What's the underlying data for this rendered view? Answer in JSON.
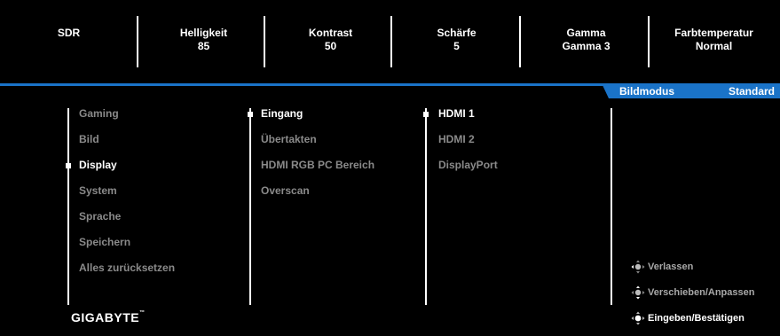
{
  "top_bar": {
    "items": [
      {
        "title": "SDR",
        "value": ""
      },
      {
        "title": "Helligkeit",
        "value": "85"
      },
      {
        "title": "Kontrast",
        "value": "50"
      },
      {
        "title": "Schärfe",
        "value": "5"
      },
      {
        "title": "Gamma",
        "value": "Gamma 3"
      },
      {
        "title": "Farbtemperatur",
        "value": "Normal"
      }
    ]
  },
  "mode_tab": {
    "label": "Bildmodus",
    "value": "Standard"
  },
  "main_menu": {
    "items": [
      "Gaming",
      "Bild",
      "Display",
      "System",
      "Sprache",
      "Speichern",
      "Alles zurücksetzen"
    ],
    "selected": "Display"
  },
  "sub_menu": {
    "items": [
      "Eingang",
      "Übertakten",
      "HDMI RGB PC Bereich",
      "Overscan"
    ],
    "selected": "Eingang"
  },
  "options_menu": {
    "items": [
      "HDMI 1",
      "HDMI 2",
      "DisplayPort"
    ],
    "selected": "HDMI 1"
  },
  "controls": {
    "exit": "Verlassen",
    "move": "Verschieben/Anpassen",
    "enter": "Eingeben/Bestätigen"
  },
  "brand": {
    "logo_text": "GIGABYTE",
    "trademark": "™"
  },
  "colors": {
    "accent": "#1a73c8",
    "inactive_text": "#8a8a8a",
    "background": "#000000"
  }
}
